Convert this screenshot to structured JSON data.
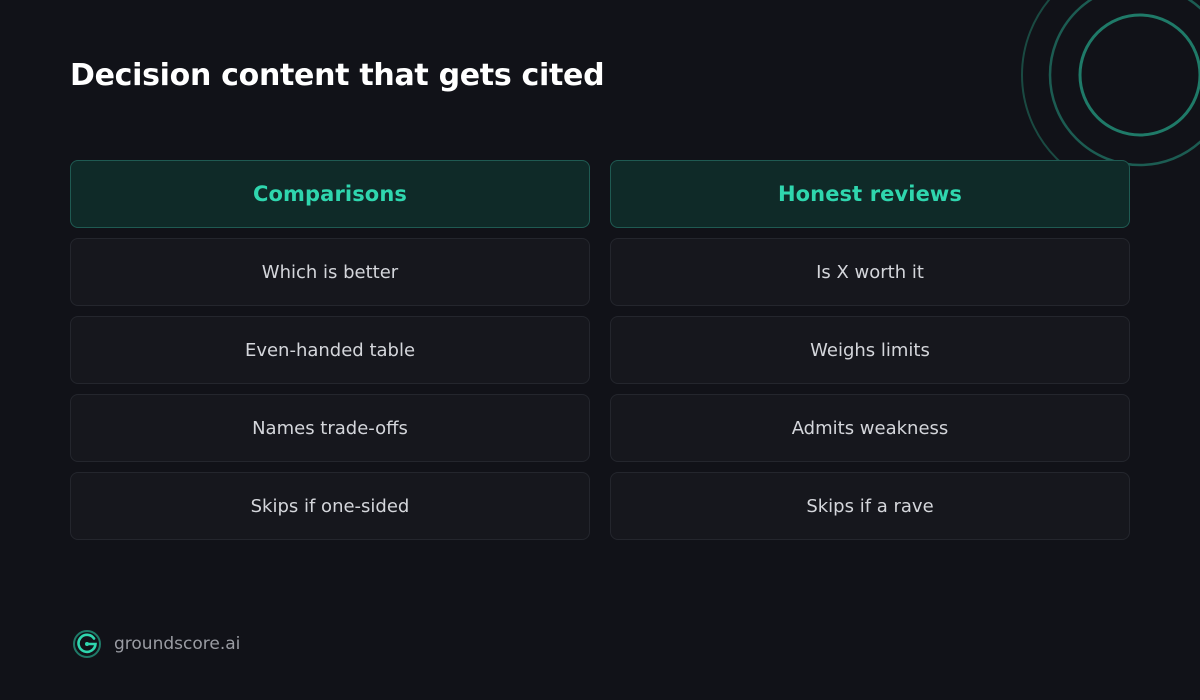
{
  "title": "Decision content that gets cited",
  "columns": [
    {
      "header": "Comparisons",
      "rows": [
        "Which is better",
        "Even-handed table",
        "Names trade-offs",
        "Skips if one-sided"
      ]
    },
    {
      "header": "Honest reviews",
      "rows": [
        "Is X worth it",
        "Weighs limits",
        "Admits weakness",
        "Skips if a rave"
      ]
    }
  ],
  "brand": {
    "name": "groundscore.ai",
    "logo_icon": "g-ring-logo-icon"
  },
  "colors": {
    "background": "#111218",
    "accent": "#2fd6ae",
    "header_bg": "#0f2a28",
    "row_bg": "#16171d"
  }
}
